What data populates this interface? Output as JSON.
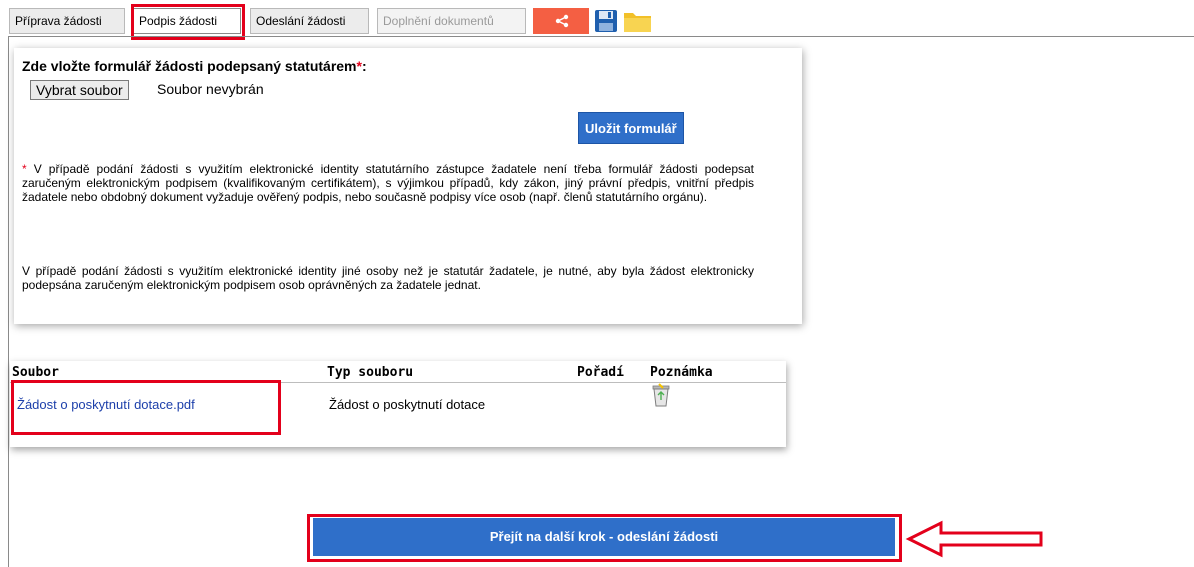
{
  "tabs": [
    {
      "label": "Příprava žádosti",
      "state": "normal"
    },
    {
      "label": "Podpis žádosti",
      "state": "active"
    },
    {
      "label": "Odeslání žádosti",
      "state": "normal"
    },
    {
      "label": "Doplnění dokumentů",
      "state": "disabled"
    }
  ],
  "toolbar_icons": [
    "share-icon",
    "save-icon",
    "folder-icon"
  ],
  "form": {
    "title": "Zde vložte formulář žádosti podepsaný statutárem",
    "required_mark": "*",
    "colon": ":",
    "file_button": "Vybrat soubor",
    "file_status": "Soubor nevybrán",
    "save_button": "Uložit formulář",
    "note1_star": "*",
    "note1_text": " V případě podání žádosti s využitím elektronické identity statutárního zástupce žadatele není třeba formulář žádosti podepsat zaručeným elektronickým podpisem (kvalifikovaným certifikátem), s výjimkou případů, kdy zákon, jiný právní předpis, vnitřní předpis žadatele nebo obdobný dokument vyžaduje ověřený podpis, nebo současně podpisy více osob (např. členů statutárního orgánu).",
    "note2_text": "V případě podání žádosti s využitím elektronické identity jiné osoby než je statutár žadatele, je nutné, aby byla žádost elektronicky podepsána zaručeným elektronickým podpisem osob oprávněných za žadatele jednat."
  },
  "files_table": {
    "headers": [
      "Soubor",
      "Typ souboru",
      "Pořadí",
      "Poznámka"
    ],
    "rows": [
      {
        "file": "Žádost o poskytnutí dotace.pdf",
        "type": "Žádost o poskytnutí dotace",
        "order": "",
        "note_icon": "recycle-bin-icon"
      }
    ]
  },
  "next_step_button": "Přejít na další krok - odeslání žádosti",
  "colors": {
    "accent_blue": "#2f6fc9",
    "share_orange": "#f45f43",
    "highlight_red": "#e3001b"
  }
}
